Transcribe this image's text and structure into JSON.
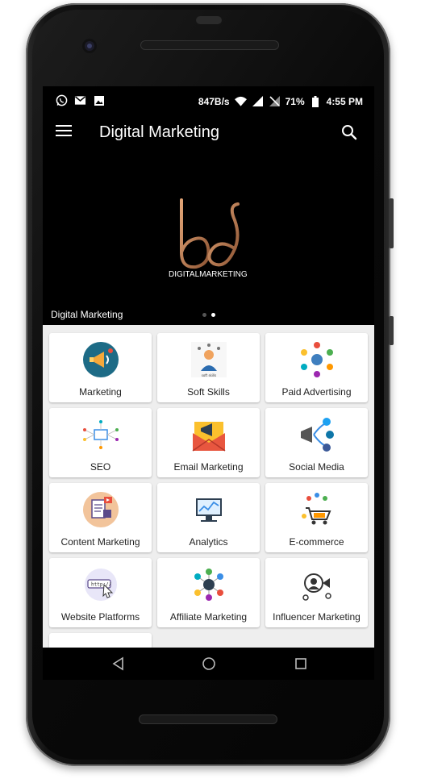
{
  "status_bar": {
    "network_speed": "847B/s",
    "battery_percent": "71%",
    "time": "4:55 PM",
    "icons": [
      "whatsapp-icon",
      "gmail-icon",
      "image-icon",
      "wifi-icon",
      "signal-icon",
      "signal-off-icon",
      "battery-icon"
    ]
  },
  "app_bar": {
    "title": "Digital Marketing",
    "menu_icon": "hamburger-menu-icon",
    "search_icon": "search-icon"
  },
  "banner": {
    "logo_text": "DIGITALMARKETING",
    "caption": "Digital Marketing",
    "page_count": 2,
    "active_page": 2
  },
  "categories": [
    {
      "label": "Marketing",
      "icon": "megaphone-icon"
    },
    {
      "label": "Soft Skills",
      "icon": "person-skills-icon"
    },
    {
      "label": "Paid Advertising",
      "icon": "ad-network-icon"
    },
    {
      "label": "SEO",
      "icon": "seo-network-icon"
    },
    {
      "label": "Email Marketing",
      "icon": "email-megaphone-icon"
    },
    {
      "label": "Social Media",
      "icon": "social-media-icon"
    },
    {
      "label": "Content Marketing",
      "icon": "content-icon"
    },
    {
      "label": "Analytics",
      "icon": "analytics-monitor-icon"
    },
    {
      "label": "E-commerce",
      "icon": "shopping-cart-icon"
    },
    {
      "label": "Website Platforms",
      "icon": "http-browser-icon"
    },
    {
      "label": "Affiliate Marketing",
      "icon": "affiliate-network-icon"
    },
    {
      "label": "Influencer Marketing",
      "icon": "influencer-icon"
    }
  ],
  "nav_bar": {
    "back": "back-triangle-icon",
    "home": "home-circle-icon",
    "recents": "recents-square-icon"
  },
  "colors": {
    "logo_copper": "#c8875a",
    "grid_background": "#eeeeee"
  }
}
